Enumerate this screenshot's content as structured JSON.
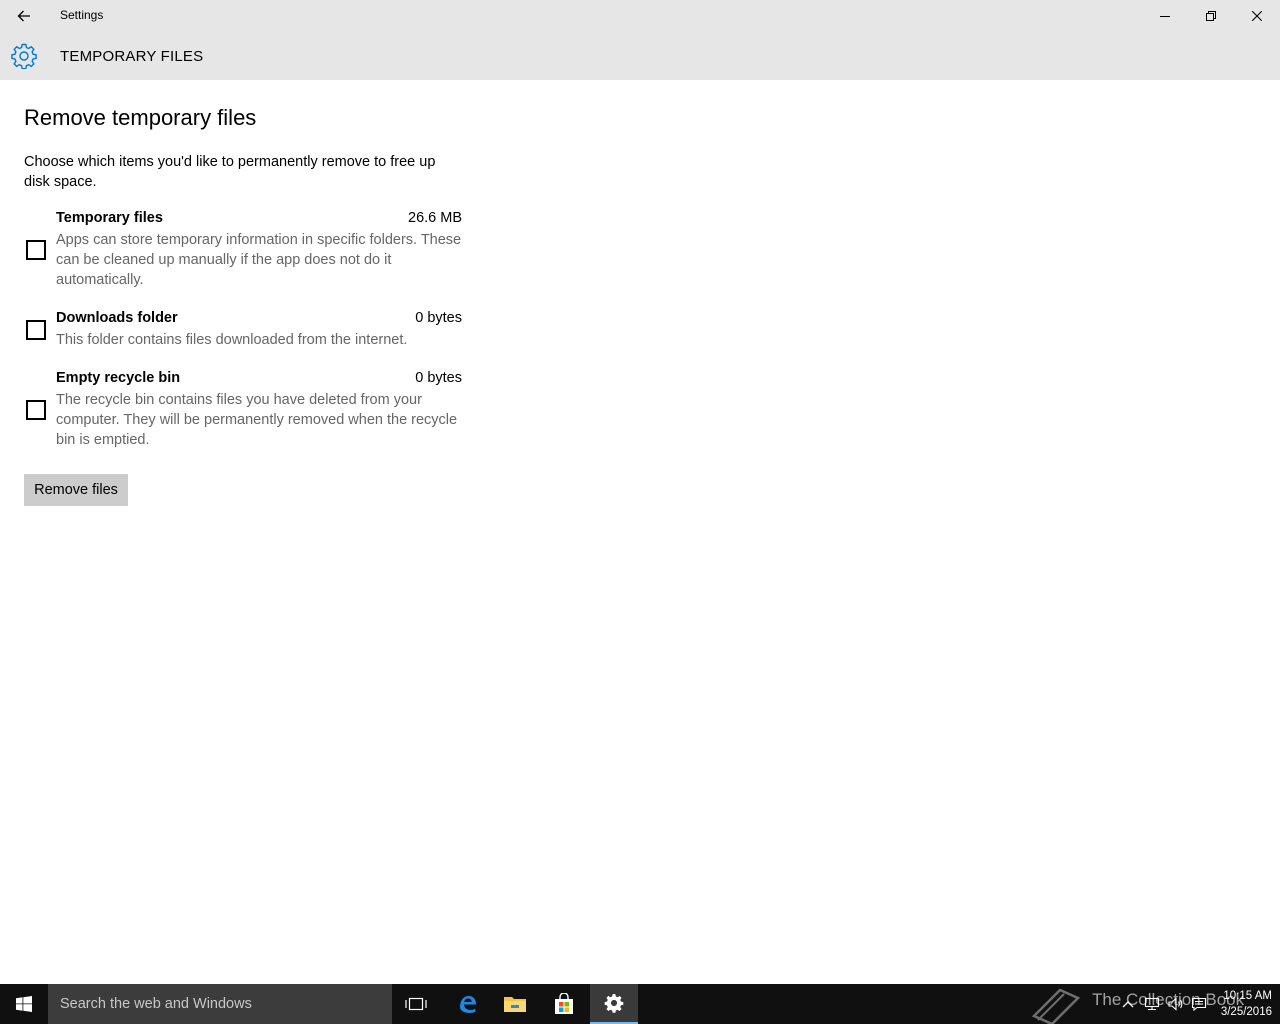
{
  "window": {
    "app_title": "Settings",
    "back_icon": "back-arrow-icon",
    "minimize_icon": "minimize-icon",
    "restore_icon": "restore-icon",
    "close_icon": "close-icon"
  },
  "header": {
    "icon": "gear-icon",
    "title": "TEMPORARY FILES",
    "accent_color": "#0078d7"
  },
  "main": {
    "section_title": "Remove temporary files",
    "intro": "Choose which items you'd like to permanently remove to free up disk space.",
    "items": [
      {
        "name": "Temporary files",
        "size": "26.6 MB",
        "description": "Apps can store temporary information in specific folders. These can be cleaned up manually if the app does not do it automatically.",
        "checked": false
      },
      {
        "name": "Downloads folder",
        "size": "0 bytes",
        "description": "This folder contains files downloaded from the internet.",
        "checked": false
      },
      {
        "name": "Empty recycle bin",
        "size": "0 bytes",
        "description": "The recycle bin contains files you have deleted from your computer. They will be permanently removed when the recycle bin is emptied.",
        "checked": false
      }
    ],
    "remove_button_label": "Remove files"
  },
  "taskbar": {
    "search_placeholder": "Search the web and Windows",
    "watermark": "The Collection Book",
    "time": "10:15 AM",
    "date": "3/25/2016",
    "pinned_icons": [
      "task-view-icon",
      "edge-icon",
      "file-explorer-icon",
      "store-icon",
      "settings-icon"
    ],
    "tray_icons": [
      "chevron-up-icon",
      "network-icon",
      "volume-icon",
      "action-center-icon"
    ]
  }
}
